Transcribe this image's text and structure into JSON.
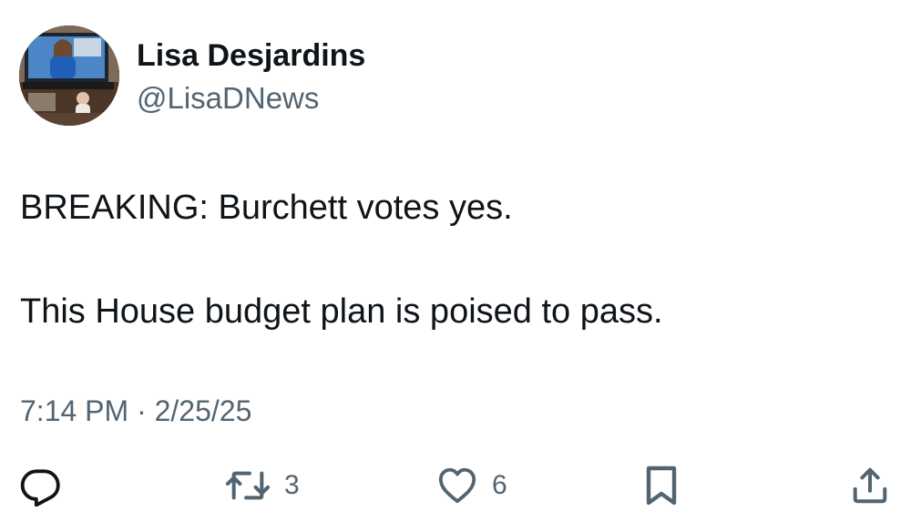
{
  "author": {
    "display_name": "Lisa Desjardins",
    "handle": "@LisaDNews"
  },
  "tweet": {
    "lines": [
      "BREAKING: Burchett votes yes.",
      "This House budget plan is poised to pass."
    ],
    "timestamp": "7:14 PM · 2/25/25"
  },
  "actions": {
    "reply": {
      "icon": "reply-icon"
    },
    "retweet": {
      "icon": "retweet-icon",
      "count": "3"
    },
    "like": {
      "icon": "heart-icon",
      "count": "6"
    },
    "bookmark": {
      "icon": "bookmark-icon"
    },
    "share": {
      "icon": "share-icon"
    }
  },
  "colors": {
    "text_primary": "#0f1419",
    "text_secondary": "#536471",
    "background": "#ffffff"
  }
}
